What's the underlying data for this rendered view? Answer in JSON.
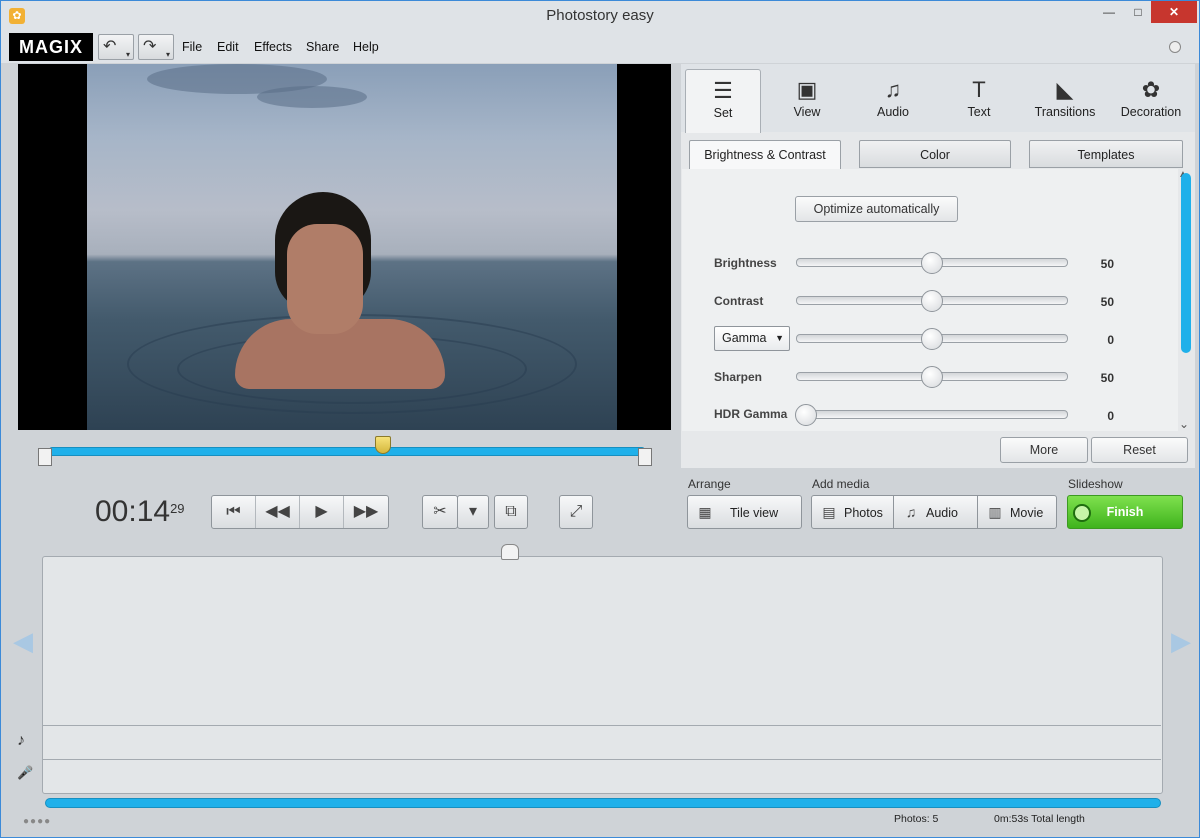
{
  "window": {
    "title": "Photostory easy",
    "minimize": "—",
    "maximize": "□",
    "close": "✕"
  },
  "menubar": {
    "logo": "MAGIX",
    "undo_icon": "↶",
    "redo_icon": "↷",
    "dropdown_icon": "▾",
    "items": [
      "File",
      "Edit",
      "Effects",
      "Share",
      "Help"
    ]
  },
  "tabs": [
    {
      "label": "Set",
      "icon": "☰",
      "icon_name": "sliders-icon"
    },
    {
      "label": "View",
      "icon": "▣",
      "icon_name": "view-icon"
    },
    {
      "label": "Audio",
      "icon": "♫",
      "icon_name": "music-note-icon"
    },
    {
      "label": "Text",
      "icon": "T",
      "icon_name": "text-icon"
    },
    {
      "label": "Transitions",
      "icon": "◣",
      "icon_name": "transition-icon"
    },
    {
      "label": "Decoration",
      "icon": "✿",
      "icon_name": "decoration-icon"
    }
  ],
  "subtabs": [
    "Brightness & Contrast",
    "Color",
    "Templates"
  ],
  "settings": {
    "optimize_label": "Optimize automatically",
    "rows": [
      {
        "label": "Brightness",
        "value": "50"
      },
      {
        "label": "Contrast",
        "value": "50"
      },
      {
        "label": "Gamma",
        "value": "0"
      },
      {
        "label": "Sharpen",
        "value": "50"
      },
      {
        "label": "HDR Gamma",
        "value": "0"
      }
    ],
    "gamma_dropdown_arrow": "▼",
    "more_label": "More",
    "reset_label": "Reset"
  },
  "transport": {
    "timecode": "00:14",
    "frames": "29",
    "buttons": [
      "⏮",
      "◀◀",
      "▶",
      "▶▶"
    ],
    "button_names": [
      "go-to-start-icon",
      "rewind-icon",
      "play-icon",
      "fast-forward-icon"
    ],
    "cut_icon": "✂",
    "cut_dropdown": "▾",
    "insert_icon": "⧉",
    "fullscreen_icon": "⤢"
  },
  "arrange": {
    "label": "Arrange",
    "tile_view_label": "Tile view",
    "tile_icon": "▦"
  },
  "add_media": {
    "label": "Add media",
    "photos_label": "Photos",
    "photos_icon": "▤",
    "audio_label": "Audio",
    "audio_icon": "♫",
    "movie_label": "Movie",
    "movie_icon": "▥"
  },
  "slideshow": {
    "label": "Slideshow",
    "finish_label": "Finish"
  },
  "storyboard": {
    "left_arrow": "◀",
    "right_arrow": "▶",
    "music_icon": "♪",
    "mic_icon": "🎤"
  },
  "status": {
    "photos": "Photos: 5",
    "total_length": "0m:53s Total length",
    "grip": "●●●●"
  },
  "colors": {
    "accent_blue": "#1fb0ea",
    "finish_green": "#4cc42a",
    "close_red": "#c7362e"
  }
}
